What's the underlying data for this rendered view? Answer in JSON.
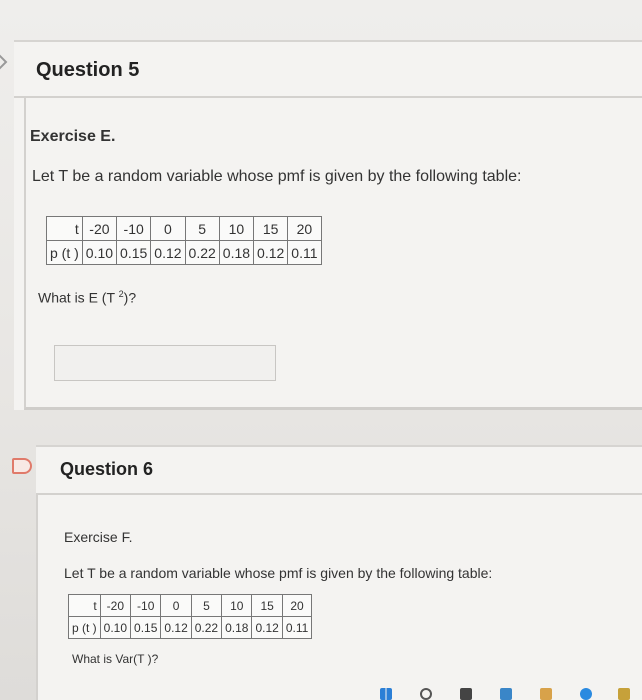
{
  "questions": [
    {
      "title": "Question 5",
      "exercise": "Exercise E.",
      "prompt": "Let T be a random variable whose pmf is given by the following table:",
      "table": {
        "row_t_label": "t",
        "t_values": [
          "-20",
          "-10",
          "0",
          "5",
          "10",
          "15",
          "20"
        ],
        "row_p_label": "p (t )",
        "p_values": [
          "0.10",
          "0.15",
          "0.12",
          "0.22",
          "0.18",
          "0.12",
          "0.11"
        ]
      },
      "question_prefix": "What is E (T ",
      "question_sup": "2",
      "question_suffix": ")?",
      "answer_value": ""
    },
    {
      "title": "Question 6",
      "exercise": "Exercise F.",
      "prompt": "Let T be a random variable whose pmf is given by the following table:",
      "table": {
        "row_t_label": "t",
        "t_values": [
          "-20",
          "-10",
          "0",
          "5",
          "10",
          "15",
          "20"
        ],
        "row_p_label": "p (t )",
        "p_values": [
          "0.10",
          "0.15",
          "0.12",
          "0.22",
          "0.18",
          "0.12",
          "0.11"
        ]
      },
      "question": "What is Var(T )?"
    }
  ],
  "colors": {
    "flag": "#e07a6a",
    "border": "#d3d1ce",
    "card": "#f4f3f1"
  },
  "icons": [
    "chevron-right-icon",
    "flag-icon"
  ],
  "taskbar_icons": [
    "windows-icon",
    "search-icon",
    "explorer-icon",
    "store-icon",
    "mail-icon",
    "chrome-icon",
    "app-icon"
  ]
}
